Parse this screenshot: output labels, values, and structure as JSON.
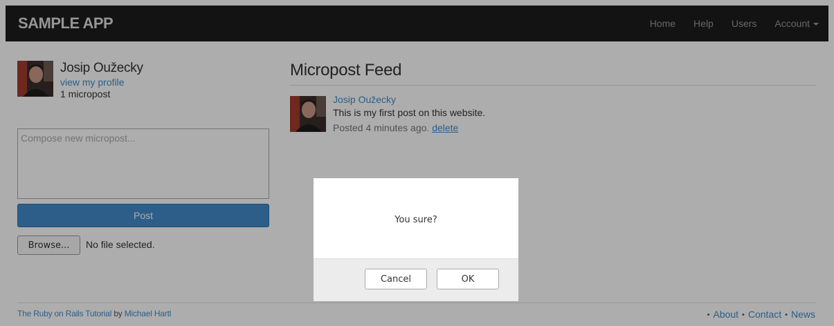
{
  "navbar": {
    "brand": "SAMPLE APP",
    "links": {
      "home": "Home",
      "help": "Help",
      "users": "Users",
      "account": "Account"
    }
  },
  "sidebar": {
    "user_name": "Josip Oužecky",
    "profile_link": "view my profile",
    "micropost_count": "1 micropost",
    "composer_placeholder": "Compose new micropost...",
    "post_button": "Post",
    "browse_button": "Browse...",
    "file_status": "No file selected."
  },
  "feed": {
    "title": "Micropost Feed",
    "items": [
      {
        "user": "Josip Oužecky",
        "content": "This is my first post on this website.",
        "posted": "Posted 4 minutes ago.",
        "delete_label": "delete"
      }
    ]
  },
  "footer": {
    "left_prefix": "The Ruby on Rails Tutorial",
    "left_by": " by ",
    "left_author": "Michael Hartl",
    "links": {
      "about": "About",
      "contact": "Contact",
      "news": "News"
    },
    "separator": "•"
  },
  "dialog": {
    "message": "You sure?",
    "cancel": "Cancel",
    "ok": "OK"
  },
  "colors": {
    "navbar_bg": "#1d1d1d",
    "link": "#428bca",
    "primary_button": "#428bca"
  }
}
